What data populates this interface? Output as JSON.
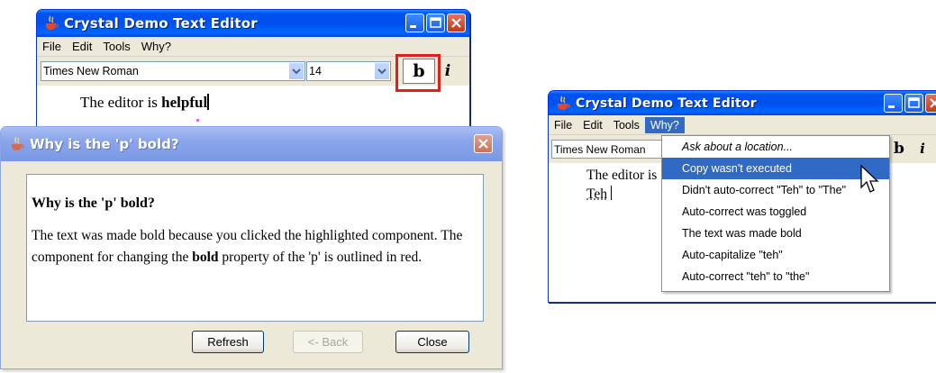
{
  "left_window": {
    "title": "Crystal Demo Text Editor",
    "menu": [
      "File",
      "Edit",
      "Tools",
      "Why?"
    ],
    "font_name": "Times New Roman",
    "font_size": "14",
    "bold_label": "b",
    "italic_label": "i",
    "editor_text_plain": "The editor is ",
    "editor_text_bold": "helpful"
  },
  "dialog": {
    "title": "Why is the 'p' bold?",
    "question": "Why is the 'p' bold?",
    "answer_part1": "The text was made bold because you clicked the highlighted component. The component for changing the ",
    "answer_bold": "bold",
    "answer_part2": " property of the 'p' is outlined in red.",
    "buttons": {
      "refresh": "Refresh",
      "back": "<- Back",
      "close": "Close"
    }
  },
  "right_window": {
    "title": "Crystal Demo Text Editor",
    "menu": [
      "File",
      "Edit",
      "Tools",
      "Why?"
    ],
    "font_name": "Times New Roman",
    "bold_label": "b",
    "italic_label": "i",
    "editor_line1": "The editor is",
    "editor_line2": "Teh",
    "why_menu": [
      "Ask about a location...",
      "Copy wasn't executed",
      "Didn't auto-correct \"Teh\" to \"The\"",
      "Auto-correct was toggled",
      "The text was made bold",
      "Auto-capitalize \"teh\"",
      "Auto-correct \"teh\" to \"the\""
    ],
    "selected_index": 1
  },
  "colors": {
    "title_blue": "#0053ee",
    "highlight_red": "#e0201b",
    "menu_select": "#316ac5"
  }
}
